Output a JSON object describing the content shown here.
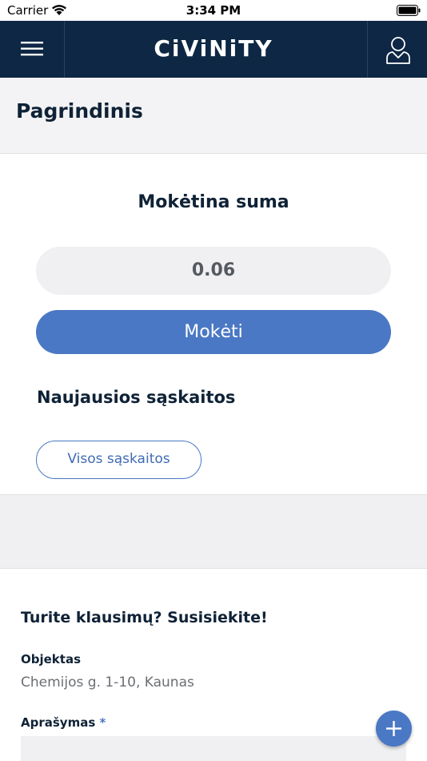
{
  "status_bar": {
    "carrier": "Carrier",
    "time": "3:34 PM"
  },
  "nav": {
    "logo": "CiViNiTY",
    "menu_icon": "hamburger-menu-icon",
    "user_icon": "user-profile-icon"
  },
  "page": {
    "title": "Pagrindinis"
  },
  "payment": {
    "title": "Mokėtina suma",
    "amount": "0.06",
    "pay_label": "Mokėti",
    "latest_title": "Naujausios sąskaitos",
    "all_bills_label": "Visos sąskaitos"
  },
  "contact": {
    "title": "Turite klausimų? Susisiekite!",
    "object_label": "Objektas",
    "object_value": "Chemijos g. 1-10, Kaunas",
    "description_label": "Aprašymas",
    "required_mark": "*"
  },
  "fab": {
    "icon": "plus-icon"
  },
  "colors": {
    "navbar": "#0e2744",
    "accent": "#4a78c4",
    "text_dark": "#0f2236",
    "background": "#f0f0f2"
  }
}
